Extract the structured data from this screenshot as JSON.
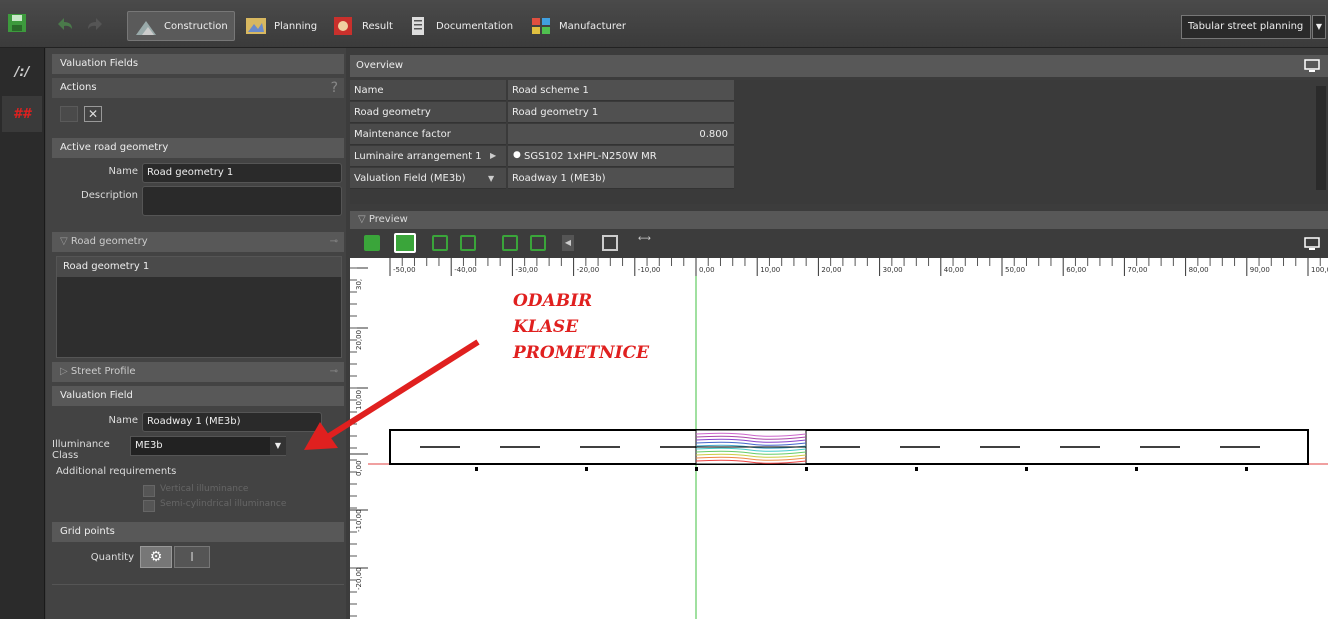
{
  "toolbar": {
    "tabs": [
      {
        "label": "Construction",
        "active": true
      },
      {
        "label": "Planning"
      },
      {
        "label": "Result"
      },
      {
        "label": "Documentation"
      },
      {
        "label": "Manufacturer"
      }
    ],
    "mode_select": "Tabular street planning"
  },
  "left_panel": {
    "valuation_fields_title": "Valuation Fields",
    "actions_title": "Actions",
    "actions_help": "?",
    "active_road_geometry_title": "Active road geometry",
    "name_label": "Name",
    "name_value": "Road geometry 1",
    "description_label": "Description",
    "description_value": "",
    "road_geometry_title": "Road geometry",
    "road_geometry_items": [
      "Road geometry 1"
    ],
    "street_profile_title": "Street Profile",
    "valuation_field_title": "Valuation Field",
    "vf_name_label": "Name",
    "vf_name_value": "Roadway 1 (ME3b)",
    "illuminance_class_label": "Illuminance Class",
    "illuminance_class_value": "ME3b",
    "additional_requirements_label": "Additional requirements",
    "checkbox_1": "Vertical illuminance",
    "checkbox_2": "Semi-cylindrical illuminance",
    "grid_points_title": "Grid points",
    "quantity_label": "Quantity"
  },
  "overview": {
    "title": "Overview",
    "rows": [
      {
        "name": "Name",
        "value": "Road scheme 1"
      },
      {
        "name": "Road geometry",
        "value": "Road geometry 1"
      },
      {
        "name": "Maintenance factor",
        "value": "0.800"
      },
      {
        "name": "Luminaire arrangement 1",
        "value": "SGS102 1xHPL-N250W MR"
      },
      {
        "name": "Valuation Field (ME3b)",
        "value": "Roadway 1 (ME3b)"
      }
    ]
  },
  "preview": {
    "title": "Preview",
    "x_ticks": [
      "-50,00",
      "-40,00",
      "-30,00",
      "-20,00",
      "-10,00",
      "0,00",
      "10,00",
      "20,00",
      "30,00",
      "40,00",
      "50,00",
      "60,00",
      "70,00",
      "80,00",
      "90,00",
      "100,0"
    ],
    "y_ticks": [
      "30,",
      "20,00",
      "10,00",
      "0,00",
      "-10,00",
      "-20,00"
    ]
  },
  "annotation": {
    "lines": [
      "ODABIR",
      "KLASE",
      "PROMETNICE"
    ],
    "color": "#e0201f"
  },
  "colors": {
    "accent_red": "#e0201f",
    "panel": "#434343",
    "header": "#585858"
  }
}
